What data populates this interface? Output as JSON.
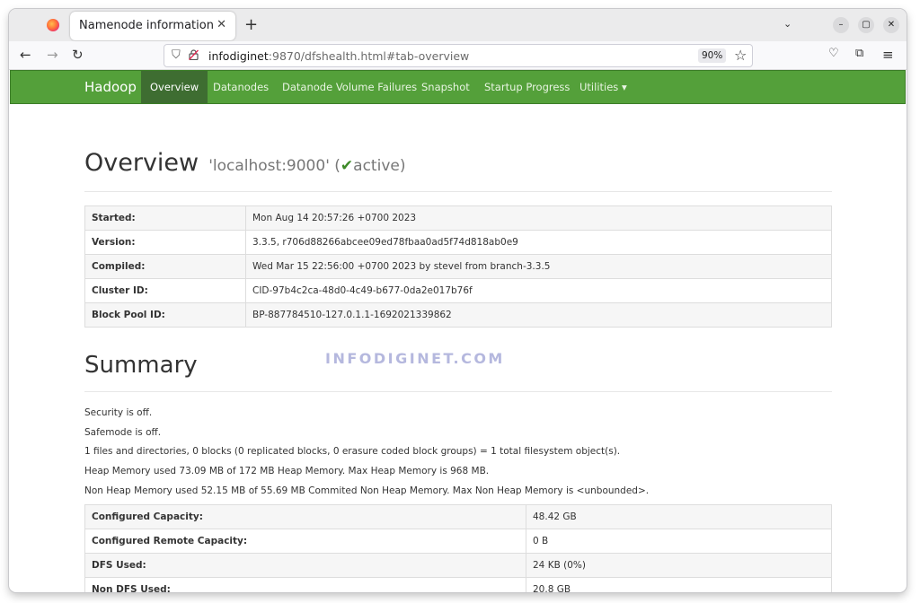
{
  "browser": {
    "tab_title": "Namenode information",
    "tab_close": "✕",
    "new_tab": "+",
    "tab_list": "⌄",
    "url_host": "infodiginet",
    "url_rest": ":9870/dfshealth.html#tab-overview",
    "zoom": "90%",
    "window_controls": [
      "–",
      "▢",
      "✕"
    ]
  },
  "nav": {
    "brand": "Hadoop",
    "items": [
      "Overview",
      "Datanodes",
      "Datanode Volume Failures",
      "Snapshot",
      "Startup Progress",
      "Utilities ▾"
    ],
    "active": "Overview",
    "color": "#54a03a"
  },
  "overview": {
    "title": "Overview",
    "host": "'localhost:9000'",
    "status_open": "(",
    "check": "✔",
    "status": "active)",
    "rows": [
      {
        "key": "Started:",
        "value": "Mon Aug 14 20:57:26 +0700 2023"
      },
      {
        "key": "Version:",
        "value": "3.3.5, r706d88266abcee09ed78fbaa0ad5f74d818ab0e9"
      },
      {
        "key": "Compiled:",
        "value": "Wed Mar 15 22:56:00 +0700 2023 by stevel from branch-3.3.5"
      },
      {
        "key": "Cluster ID:",
        "value": "CID-97b4c2ca-48d0-4c49-b677-0da2e017b76f"
      },
      {
        "key": "Block Pool ID:",
        "value": "BP-887784510-127.0.1.1-1692021339862"
      }
    ]
  },
  "summary": {
    "title": "Summary",
    "watermark": "INFODIGINET.COM",
    "lines": [
      "Security is off.",
      "Safemode is off.",
      "1 files and directories, 0 blocks (0 replicated blocks, 0 erasure coded block groups) = 1 total filesystem object(s).",
      "Heap Memory used 73.09 MB of 172 MB Heap Memory. Max Heap Memory is 968 MB.",
      "Non Heap Memory used 52.15 MB of 55.69 MB Commited Non Heap Memory. Max Non Heap Memory is <unbounded>."
    ],
    "rows": [
      {
        "key": "Configured Capacity:",
        "value": "48.42 GB"
      },
      {
        "key": "Configured Remote Capacity:",
        "value": "0 B"
      },
      {
        "key": "DFS Used:",
        "value": "24 KB (0%)"
      },
      {
        "key": "Non DFS Used:",
        "value": "20.8 GB"
      }
    ]
  }
}
